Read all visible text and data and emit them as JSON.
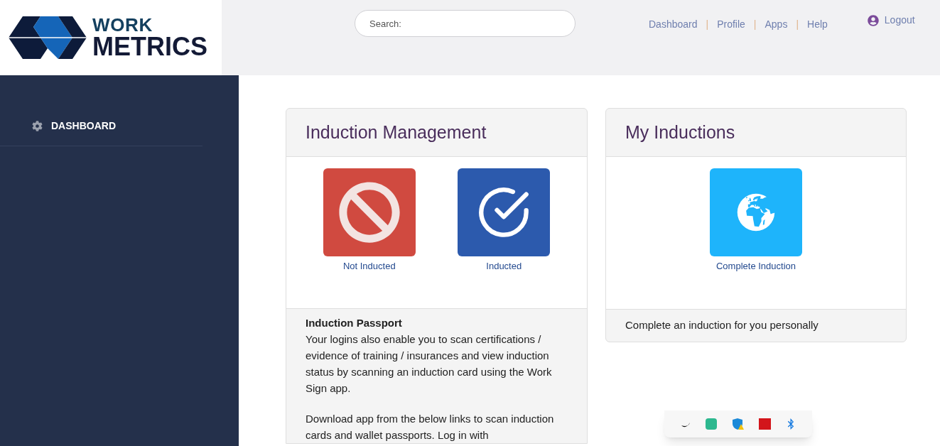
{
  "logo": {
    "line_1": "WORK",
    "line_2": "METRICS"
  },
  "search": {
    "placeholder": "Search:"
  },
  "nav_separator": "|",
  "top_nav": [
    {
      "label": "Dashboard"
    },
    {
      "label": "Profile"
    },
    {
      "label": "Apps"
    },
    {
      "label": "Help"
    }
  ],
  "logout": {
    "label": "Logout"
  },
  "sidebar": {
    "items": [
      {
        "label": "DASHBOARD",
        "selected": true
      }
    ]
  },
  "panels": [
    {
      "title": "Induction Management",
      "tiles": [
        {
          "kind": "not_inducted",
          "label": "Not Inducted",
          "color": "#d04a40"
        },
        {
          "kind": "inducted",
          "label": "Inducted",
          "color": "#2c5aad"
        }
      ],
      "footer": {
        "heading": "Induction Passport",
        "paragraphs": [
          "Your logins also enable you to scan certifications / evidence of training / insurances and view induction status by scanning an induction card using the Work Sign app.",
          "Download app from the below links to scan induction cards and wallet passports. Log in with"
        ]
      }
    },
    {
      "title": "My Inductions",
      "tiles": [
        {
          "kind": "complete",
          "label": "Complete Induction",
          "color": "#1eb4fb"
        }
      ],
      "footer": {
        "paragraphs": [
          "Complete an induction for you personally"
        ]
      }
    }
  ],
  "tray": [
    {
      "kind": "moon"
    },
    {
      "kind": "green_app"
    },
    {
      "kind": "shield"
    },
    {
      "kind": "red_app"
    },
    {
      "kind": "bluetooth"
    }
  ]
}
